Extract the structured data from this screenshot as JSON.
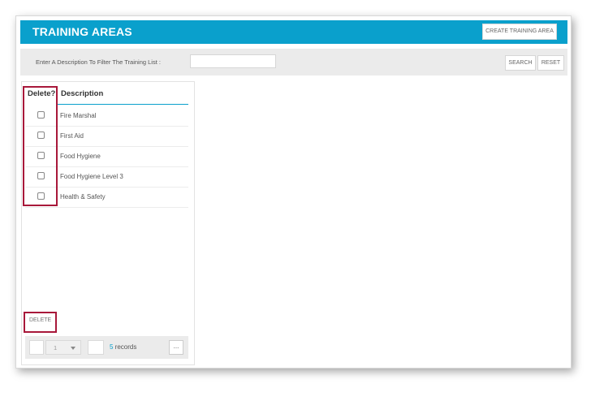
{
  "header": {
    "title": "TRAINING AREAS",
    "create_label": "CREATE TRAINING AREA"
  },
  "filter": {
    "label": "Enter A Description To Filter The Training List :",
    "value": "",
    "search_label": "SEARCH",
    "reset_label": "RESET"
  },
  "table": {
    "columns": [
      "Delete?",
      "Description"
    ],
    "rows": [
      {
        "description": "Fire Marshal",
        "checked": false
      },
      {
        "description": "First Aid",
        "checked": false
      },
      {
        "description": "Food Hygiene",
        "checked": false
      },
      {
        "description": "Food Hygiene Level 3",
        "checked": false
      },
      {
        "description": "Health & Safety",
        "checked": false
      }
    ]
  },
  "actions": {
    "delete_label": "DELETE"
  },
  "pager": {
    "page": "1",
    "record_count": "5",
    "records_suffix": " records",
    "more_label": "..."
  },
  "colors": {
    "accent": "#0aa0cc",
    "highlight": "#a8183a"
  }
}
